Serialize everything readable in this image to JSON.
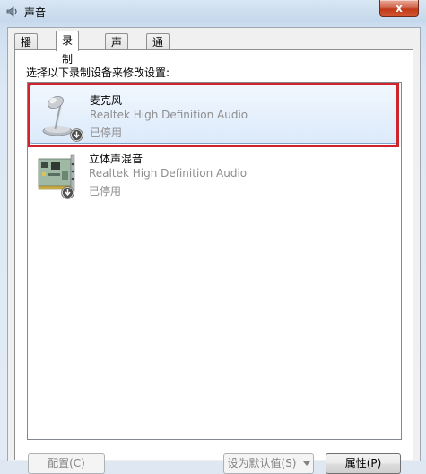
{
  "window": {
    "title": "声音",
    "close_glyph": "x"
  },
  "tabs": [
    {
      "label": "播放",
      "active": false
    },
    {
      "label": "录制",
      "active": true
    },
    {
      "label": "声音",
      "active": false
    },
    {
      "label": "通信",
      "active": false
    }
  ],
  "instruction": "选择以下录制设备来修改设置:",
  "devices": [
    {
      "name": "麦克风",
      "driver": "Realtek High Definition Audio",
      "status": "已停用",
      "icon": "microphone-icon",
      "selected": true
    },
    {
      "name": "立体声混音",
      "driver": "Realtek High Definition Audio",
      "status": "已停用",
      "icon": "sound-card-icon",
      "selected": false
    }
  ],
  "buttons": {
    "configure": "配置(C)",
    "set_default": "设为默认值(S)",
    "properties": "属性(P)"
  },
  "colors": {
    "highlight": "#d0242c",
    "selection": "#dceafa",
    "close_button": "#c1391a"
  }
}
